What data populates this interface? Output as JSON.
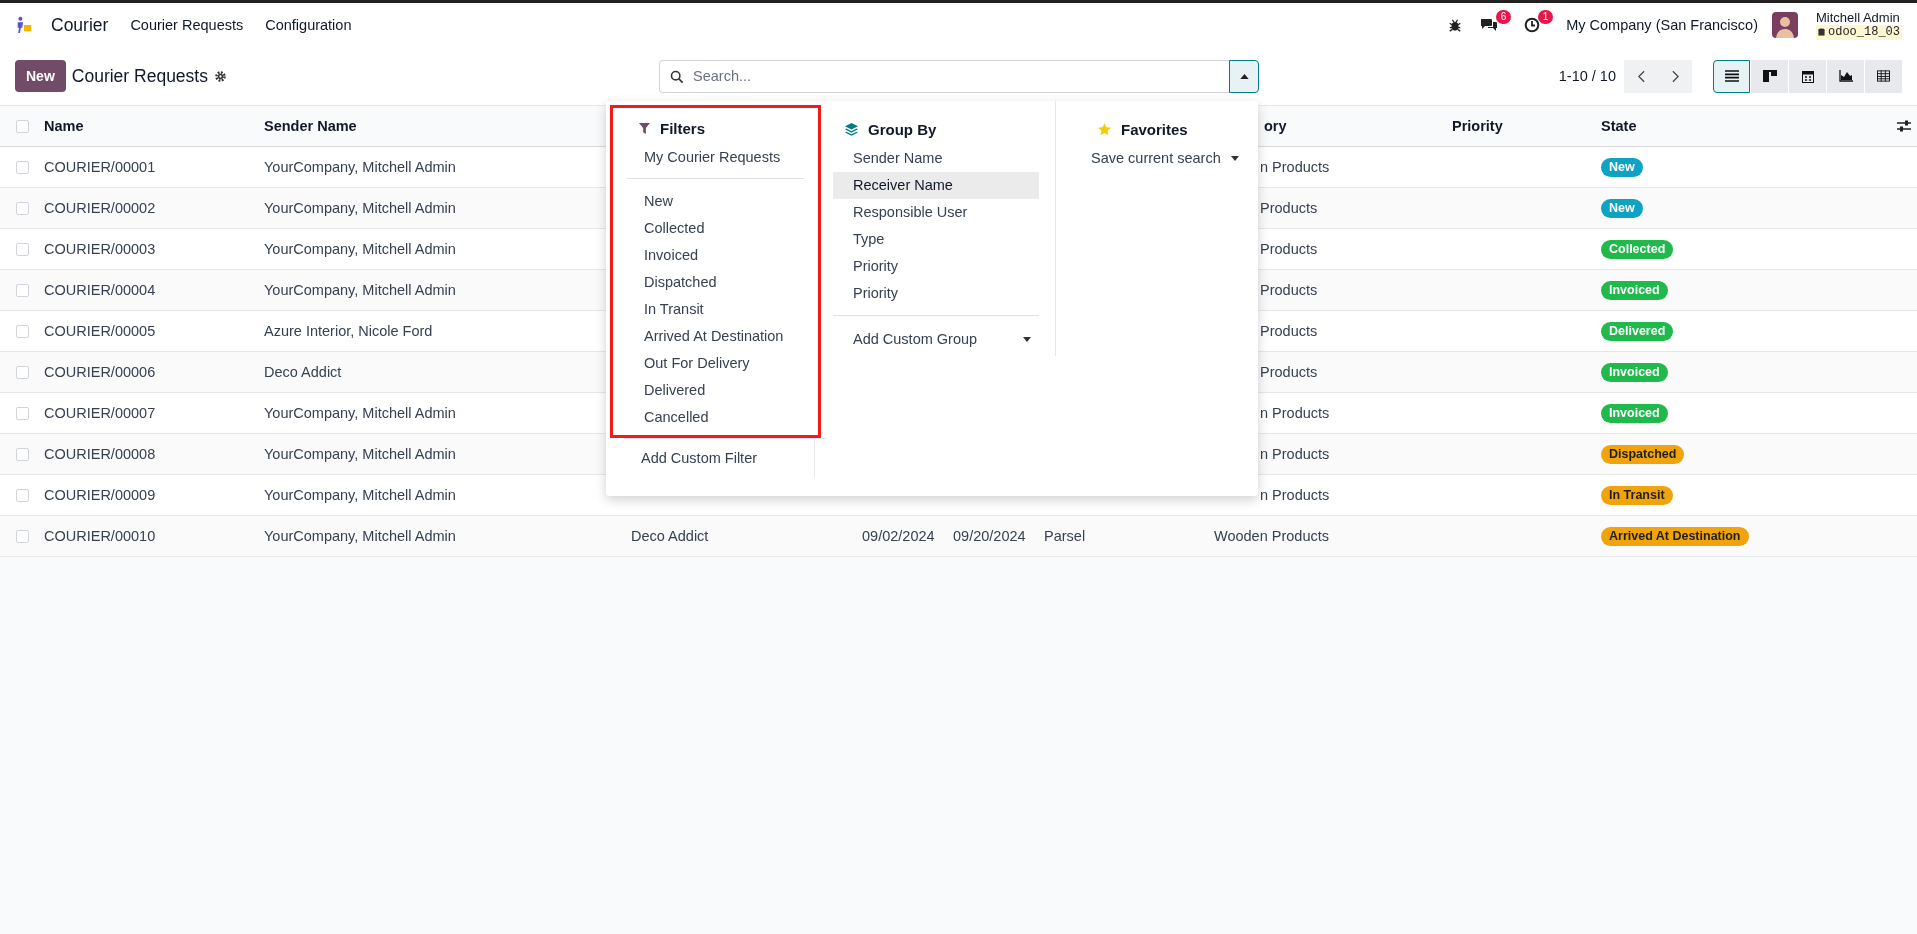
{
  "navbar": {
    "app_name": "Courier",
    "menus": [
      "Courier Requests",
      "Configuration"
    ],
    "messages_count": "6",
    "activities_count": "1",
    "company": "My Company (San Francisco)",
    "user_name": "Mitchell Admin",
    "database": "odoo_18_03"
  },
  "control_panel": {
    "new_button": "New",
    "title": "Courier Requests",
    "search": {
      "placeholder": "Search...",
      "panel_open": true
    },
    "pager": "1-10 / 10",
    "views": [
      {
        "kind": "list",
        "selected": true
      },
      {
        "kind": "kanban",
        "selected": false
      },
      {
        "kind": "calendar",
        "selected": false
      },
      {
        "kind": "graph",
        "selected": false
      },
      {
        "kind": "pivot",
        "selected": false
      }
    ]
  },
  "search_panel": {
    "filters": {
      "title": "Filters",
      "groups": [
        [
          "My Courier Requests"
        ],
        [
          "New",
          "Collected",
          "Invoiced",
          "Dispatched",
          "In Transit",
          "Arrived At Destination",
          "Out For Delivery",
          "Delivered",
          "Cancelled"
        ]
      ],
      "add_custom": "Add Custom Filter",
      "highlighted": true
    },
    "group_by": {
      "title": "Group By",
      "items": [
        {
          "label": "Sender Name",
          "selected": false
        },
        {
          "label": "Receiver Name",
          "selected": true
        },
        {
          "label": "Responsible User",
          "selected": false
        },
        {
          "label": "Type",
          "selected": false
        },
        {
          "label": "Priority",
          "selected": false
        },
        {
          "label": "Priority",
          "selected": false
        }
      ],
      "add_custom": "Add Custom Group"
    },
    "favorites": {
      "title": "Favorites",
      "save": "Save current search"
    }
  },
  "table": {
    "all_checked": false,
    "columns": {
      "name": "Name",
      "sender_name": "Sender Name",
      "category": "ory",
      "priority": "Priority",
      "state": "State"
    },
    "rows": [
      {
        "name": "COURIER/00001",
        "sender_name": "YourCompany, Mitchell Admin",
        "checked": false,
        "covered": true,
        "category": "n Products",
        "state": {
          "label": "New",
          "color": "#0fa3c3"
        }
      },
      {
        "name": "COURIER/00002",
        "sender_name": "YourCompany, Mitchell Admin",
        "checked": false,
        "covered": true,
        "category": "Products",
        "state": {
          "label": "New",
          "color": "#0fa3c3"
        }
      },
      {
        "name": "COURIER/00003",
        "sender_name": "YourCompany, Mitchell Admin",
        "checked": false,
        "covered": true,
        "category": "Products",
        "state": {
          "label": "Collected",
          "color": "#1fb94c"
        }
      },
      {
        "name": "COURIER/00004",
        "sender_name": "YourCompany, Mitchell Admin",
        "checked": false,
        "covered": true,
        "category": "Products",
        "state": {
          "label": "Invoiced",
          "color": "#1fb94c"
        }
      },
      {
        "name": "COURIER/00005",
        "sender_name": "Azure Interior, Nicole Ford",
        "checked": false,
        "covered": true,
        "category": "Products",
        "state": {
          "label": "Delivered",
          "color": "#1fb94c"
        }
      },
      {
        "name": "COURIER/00006",
        "sender_name": "Deco Addict",
        "checked": false,
        "covered": true,
        "category": "Products",
        "state": {
          "label": "Invoiced",
          "color": "#1fb94c"
        }
      },
      {
        "name": "COURIER/00007",
        "sender_name": "YourCompany, Mitchell Admin",
        "checked": false,
        "covered": true,
        "category": "n Products",
        "state": {
          "label": "Invoiced",
          "color": "#1fb94c"
        }
      },
      {
        "name": "COURIER/00008",
        "sender_name": "YourCompany, Mitchell Admin",
        "checked": false,
        "covered": true,
        "category": "n Products",
        "state": {
          "label": "Dispatched",
          "color": "#f0a30a"
        }
      },
      {
        "name": "COURIER/00009",
        "sender_name": "YourCompany, Mitchell Admin",
        "checked": false,
        "covered": true,
        "category": "n Products",
        "state": {
          "label": "In Transit",
          "color": "#f0a30a"
        }
      },
      {
        "name": "COURIER/00010",
        "sender_name": "YourCompany, Mitchell Admin",
        "checked": false,
        "receiver_name": "Deco Addict",
        "date_1": "09/02/2024",
        "date_2": "09/20/2024",
        "type": "Parsel",
        "category": "Wooden Products",
        "state": {
          "label": "Arrived At Destination",
          "color": "#f0a30a"
        }
      }
    ]
  }
}
